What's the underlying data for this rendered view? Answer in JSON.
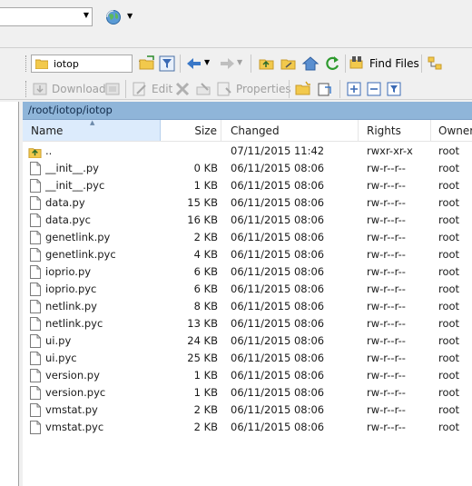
{
  "remote_toolbar": {
    "directory": "iotop",
    "find_files_label": "Find Files"
  },
  "edit_toolbar": {
    "download_label": "Download",
    "edit_label": "Edit",
    "properties_label": "Properties"
  },
  "path_bar": {
    "path": "/root/iotop/iotop"
  },
  "file_list": {
    "columns": {
      "name": "Name",
      "size": "Size",
      "changed": "Changed",
      "rights": "Rights",
      "owner": "Owner"
    },
    "rows": [
      {
        "name": "..",
        "size": "",
        "changed": "07/11/2015 11:42",
        "rights": "rwxr-xr-x",
        "owner": "root",
        "type": "parent"
      },
      {
        "name": "__init__.py",
        "size": "0 KB",
        "changed": "06/11/2015 08:06",
        "rights": "rw-r--r--",
        "owner": "root",
        "type": "file"
      },
      {
        "name": "__init__.pyc",
        "size": "1 KB",
        "changed": "06/11/2015 08:06",
        "rights": "rw-r--r--",
        "owner": "root",
        "type": "file"
      },
      {
        "name": "data.py",
        "size": "15 KB",
        "changed": "06/11/2015 08:06",
        "rights": "rw-r--r--",
        "owner": "root",
        "type": "file"
      },
      {
        "name": "data.pyc",
        "size": "16 KB",
        "changed": "06/11/2015 08:06",
        "rights": "rw-r--r--",
        "owner": "root",
        "type": "file"
      },
      {
        "name": "genetlink.py",
        "size": "2 KB",
        "changed": "06/11/2015 08:06",
        "rights": "rw-r--r--",
        "owner": "root",
        "type": "file"
      },
      {
        "name": "genetlink.pyc",
        "size": "4 KB",
        "changed": "06/11/2015 08:06",
        "rights": "rw-r--r--",
        "owner": "root",
        "type": "file"
      },
      {
        "name": "ioprio.py",
        "size": "6 KB",
        "changed": "06/11/2015 08:06",
        "rights": "rw-r--r--",
        "owner": "root",
        "type": "file"
      },
      {
        "name": "ioprio.pyc",
        "size": "6 KB",
        "changed": "06/11/2015 08:06",
        "rights": "rw-r--r--",
        "owner": "root",
        "type": "file"
      },
      {
        "name": "netlink.py",
        "size": "8 KB",
        "changed": "06/11/2015 08:06",
        "rights": "rw-r--r--",
        "owner": "root",
        "type": "file"
      },
      {
        "name": "netlink.pyc",
        "size": "13 KB",
        "changed": "06/11/2015 08:06",
        "rights": "rw-r--r--",
        "owner": "root",
        "type": "file"
      },
      {
        "name": "ui.py",
        "size": "24 KB",
        "changed": "06/11/2015 08:06",
        "rights": "rw-r--r--",
        "owner": "root",
        "type": "file"
      },
      {
        "name": "ui.pyc",
        "size": "25 KB",
        "changed": "06/11/2015 08:06",
        "rights": "rw-r--r--",
        "owner": "root",
        "type": "file"
      },
      {
        "name": "version.py",
        "size": "1 KB",
        "changed": "06/11/2015 08:06",
        "rights": "rw-r--r--",
        "owner": "root",
        "type": "file"
      },
      {
        "name": "version.pyc",
        "size": "1 KB",
        "changed": "06/11/2015 08:06",
        "rights": "rw-r--r--",
        "owner": "root",
        "type": "file"
      },
      {
        "name": "vmstat.py",
        "size": "2 KB",
        "changed": "06/11/2015 08:06",
        "rights": "rw-r--r--",
        "owner": "root",
        "type": "file"
      },
      {
        "name": "vmstat.pyc",
        "size": "2 KB",
        "changed": "06/11/2015 08:06",
        "rights": "rw-r--r--",
        "owner": "root",
        "type": "file"
      }
    ]
  },
  "colors": {
    "path_bar": "#8fb5d9",
    "header_selected": "#dcebfc",
    "window_bg": "#f0f0f0"
  }
}
